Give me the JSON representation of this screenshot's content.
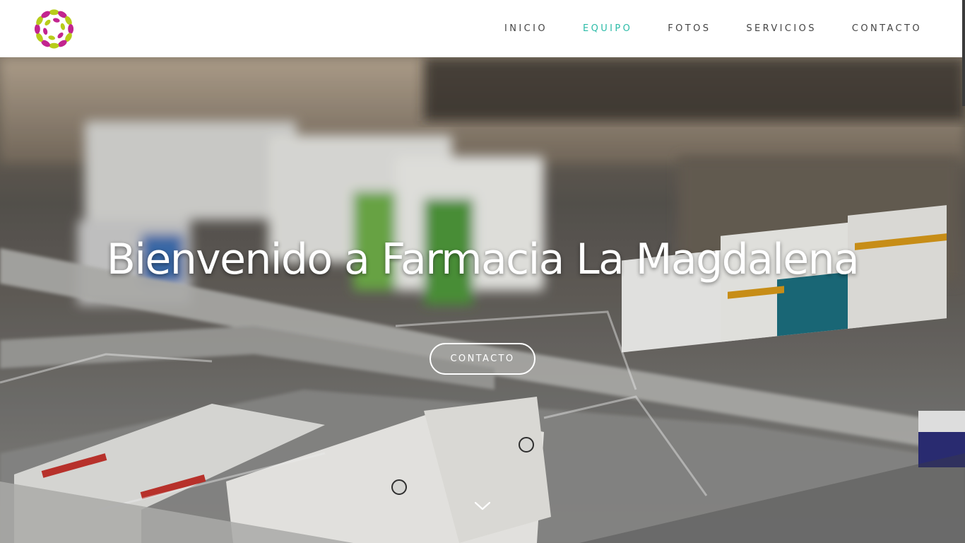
{
  "nav": {
    "items": [
      {
        "label": "INICIO",
        "active": false
      },
      {
        "label": "EQUIPO",
        "active": true
      },
      {
        "label": "FOTOS",
        "active": false
      },
      {
        "label": "SERVICIOS",
        "active": false
      },
      {
        "label": "CONTACTO",
        "active": false
      }
    ]
  },
  "hero": {
    "title": "Bienvenido a Farmacia La Magdalena",
    "button_label": "CONTACTO",
    "scroll_icon": "chevron-down-icon"
  },
  "colors": {
    "accent": "#2bbba7",
    "nav_text": "#444444",
    "logo_magenta": "#c2258f",
    "logo_lime": "#b8cc1a"
  },
  "logo_icon": "pharmacy-ring-logo"
}
